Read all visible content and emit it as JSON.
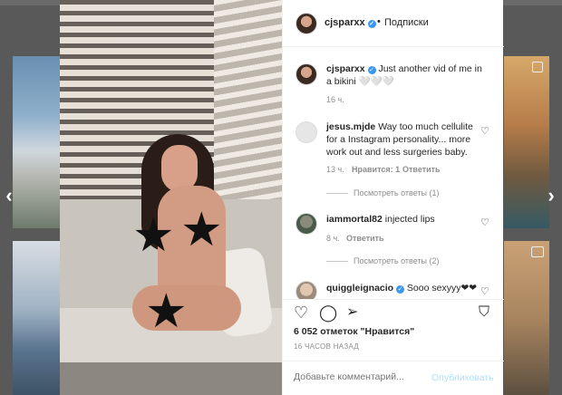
{
  "colors": {
    "accent": "#3897f0",
    "publish_disabled": "#b2dffc",
    "muted": "#8e8e8e"
  },
  "icons": {
    "nav_prev": "chevron-left-icon",
    "nav_next": "chevron-right-icon",
    "mute": "speaker-muted-icon",
    "heart": "heart-icon",
    "comment": "comment-icon",
    "share": "paper-plane-icon",
    "save": "bookmark-icon",
    "verified": "verified-badge-icon"
  },
  "nav": {
    "prev": "‹",
    "next": "›"
  },
  "header": {
    "username": "cjsparxx",
    "separator": "•",
    "follow_label": "Подписки"
  },
  "caption": {
    "username": "cjsparxx",
    "text": " Just another vid of me in a bikini 🤍🤍🤍",
    "time": "16 ч."
  },
  "comments": [
    {
      "username": "jesus.mjde",
      "text": " Way too much cellulite for a Instagram personality... more work out and less surgeries baby.",
      "time": "13 ч.",
      "likes": "Нравится: 1",
      "reply": "Ответить",
      "replies": "Посмотреть ответы (1)"
    },
    {
      "username": "iammortal82",
      "text": " injected lips",
      "time": "8 ч.",
      "reply": "Ответить",
      "replies": "Посмотреть ответы (2)"
    },
    {
      "username": "quigglеignacio",
      "text": " Sooo sexyyy❤❤"
    }
  ],
  "likes_text": "6 052 отметок \"Нравится\"",
  "timestamp": "16 ЧАСОВ НАЗАД",
  "comment_box": {
    "placeholder": "Добавьте комментарий...",
    "publish": "Опубликовать"
  }
}
